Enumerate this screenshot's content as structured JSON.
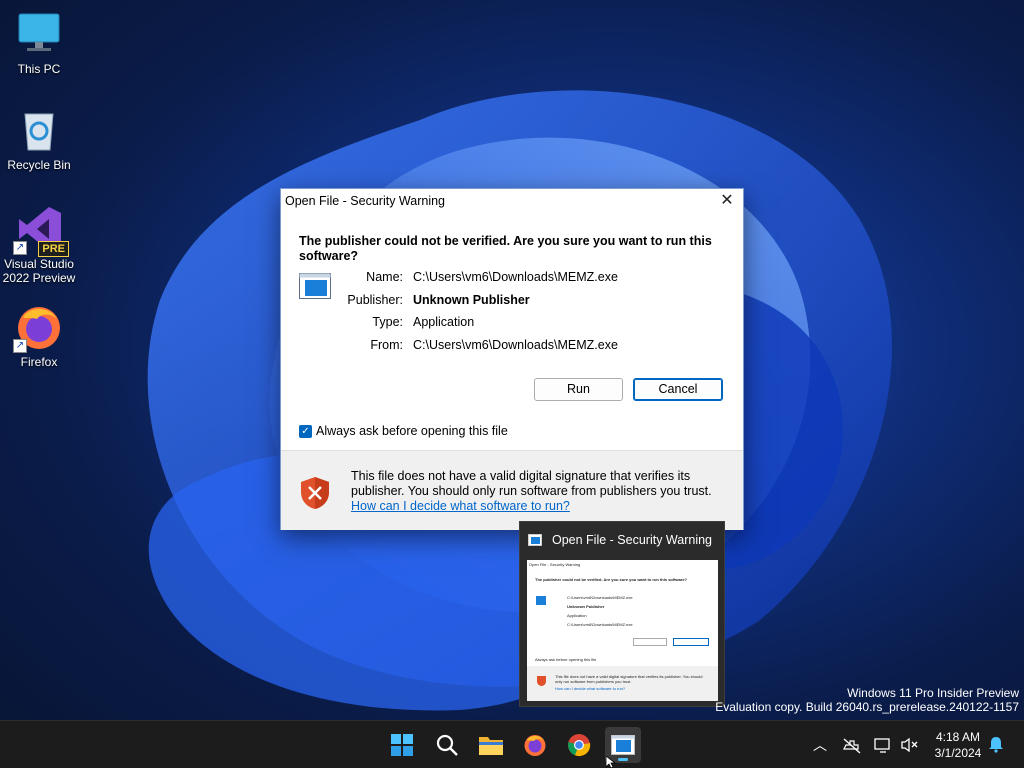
{
  "desktop": {
    "icons": [
      {
        "label": "This PC",
        "icon": "monitor-icon"
      },
      {
        "label": "Recycle Bin",
        "icon": "recycle-bin-icon"
      },
      {
        "label": "Visual Studio 2022 Preview",
        "icon": "visual-studio-icon",
        "badge": "PRE"
      },
      {
        "label": "Firefox",
        "icon": "firefox-icon"
      }
    ]
  },
  "dialog": {
    "title": "Open File - Security Warning",
    "close_glyph": "✕",
    "question": "The publisher could not be verified.  Are you sure you want to run this software?",
    "fields": [
      {
        "key": "Name:",
        "value": "C:\\Users\\vm6\\Downloads\\MEMZ.exe"
      },
      {
        "key": "Publisher:",
        "value": "Unknown Publisher"
      },
      {
        "key": "Type:",
        "value": "Application"
      },
      {
        "key": "From:",
        "value": "C:\\Users\\vm6\\Downloads\\MEMZ.exe"
      }
    ],
    "run_label": "Run",
    "cancel_label": "Cancel",
    "checkbox_label": "Always ask before opening this file",
    "checkbox_checked": true,
    "footer_text": "This file does not have a valid digital signature that verifies its publisher.  You should only run software from publishers you trust.",
    "help_link": "How can I decide what software to run?"
  },
  "thumbnail": {
    "title": "Open File - Security Warning"
  },
  "watermark": {
    "line1": "Windows 11 Pro Insider Preview",
    "line2": "Evaluation copy. Build 26040.rs_prerelease.240122-1157"
  },
  "taskbar": {
    "apps": [
      "start-icon",
      "search-icon",
      "file-explorer-icon",
      "firefox-icon",
      "chrome-icon",
      "security-warning-app-icon"
    ],
    "tray": [
      "chevron-up-icon",
      "network-off-icon",
      "display-icon",
      "volume-muted-icon",
      "notification-bell-icon"
    ],
    "time": "4:18 AM",
    "date": "3/1/2024"
  },
  "colors": {
    "accent": "#0067c0",
    "link": "#0066cc",
    "taskbar": "#1c1c1c",
    "active_indicator": "#4cc2ff"
  }
}
